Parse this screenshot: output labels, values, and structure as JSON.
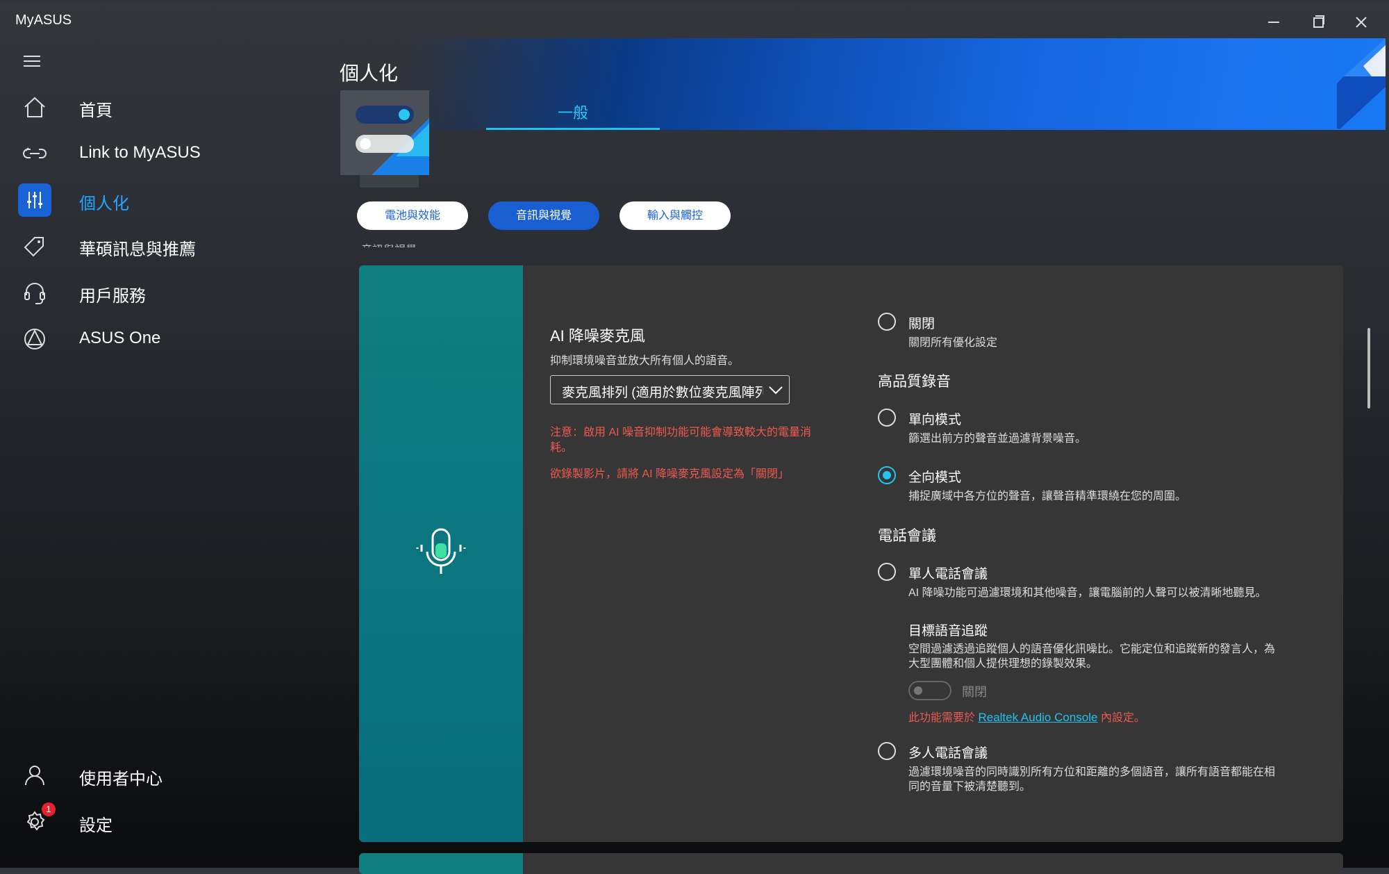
{
  "window": {
    "title": "MyASUS"
  },
  "sidebar": {
    "items": [
      {
        "label": "首頁",
        "icon": "home-icon"
      },
      {
        "label": "Link to MyASUS",
        "icon": "link-icon"
      },
      {
        "label": "個人化",
        "icon": "sliders-icon",
        "active": true
      },
      {
        "label": "華碩訊息與推薦",
        "icon": "tag-icon"
      },
      {
        "label": "用戶服務",
        "icon": "headset-icon"
      },
      {
        "label": "ASUS One",
        "icon": "asus-one-icon"
      }
    ],
    "bottom": [
      {
        "label": "使用者中心",
        "icon": "user-icon"
      },
      {
        "label": "設定",
        "icon": "gear-icon",
        "badge": "1"
      }
    ]
  },
  "header": {
    "title": "個人化",
    "tab": "一般"
  },
  "categories": [
    {
      "label": "電池與效能"
    },
    {
      "label": "音訊與視覺",
      "active": true
    },
    {
      "label": "輸入與觸控"
    }
  ],
  "section_peek": "音訊與視覺",
  "ai_mic": {
    "title": "AI 降噪麥克風",
    "desc": "抑制環境噪音並放大所有個人的語音。",
    "dropdown_value": "麥克風排列 (適用於數位麥克風陣列)",
    "warning1": "注意：啟用 AI 噪音抑制功能可能會導致較大的電量消耗。",
    "warning2": "欲錄製影片，請將 AI 降噪麥克風設定為「關閉」"
  },
  "options": {
    "off": {
      "label": "關閉",
      "desc": "關閉所有優化設定"
    },
    "hq_title": "高品質錄音",
    "uni": {
      "label": "單向模式",
      "desc": "篩選出前方的聲音並過濾背景噪音。"
    },
    "omni": {
      "label": "全向模式",
      "desc": "捕捉廣域中各方位的聲音，讓聲音精準環繞在您的周圍。"
    },
    "call_title": "電話會議",
    "single": {
      "label": "單人電話會議",
      "desc": "AI 降噪功能可過濾環境和其他噪音，讓電腦前的人聲可以被清晰地聽見。"
    },
    "tracking": {
      "title": "目標語音追蹤",
      "desc": "空間過濾透過追蹤個人的語音優化訊噪比。它能定位和追蹤新的發言人，為大型團體和個人提供理想的錄製效果。",
      "toggle_label": "關閉",
      "req_prefix": "此功能需要於",
      "req_link": "Realtek Audio Console",
      "req_suffix": "內設定。"
    },
    "multi": {
      "label": "多人電話會議",
      "desc": "過濾環境噪音的同時識別所有方位和距離的多個語音，讓所有語音都能在相同的音量下被清楚聽到。"
    }
  },
  "colors": {
    "accent_blue": "#1a63d6",
    "accent_cyan": "#22c3f0",
    "warning_red": "#ee5a4f",
    "panel_teal": "#0f7f7f"
  }
}
